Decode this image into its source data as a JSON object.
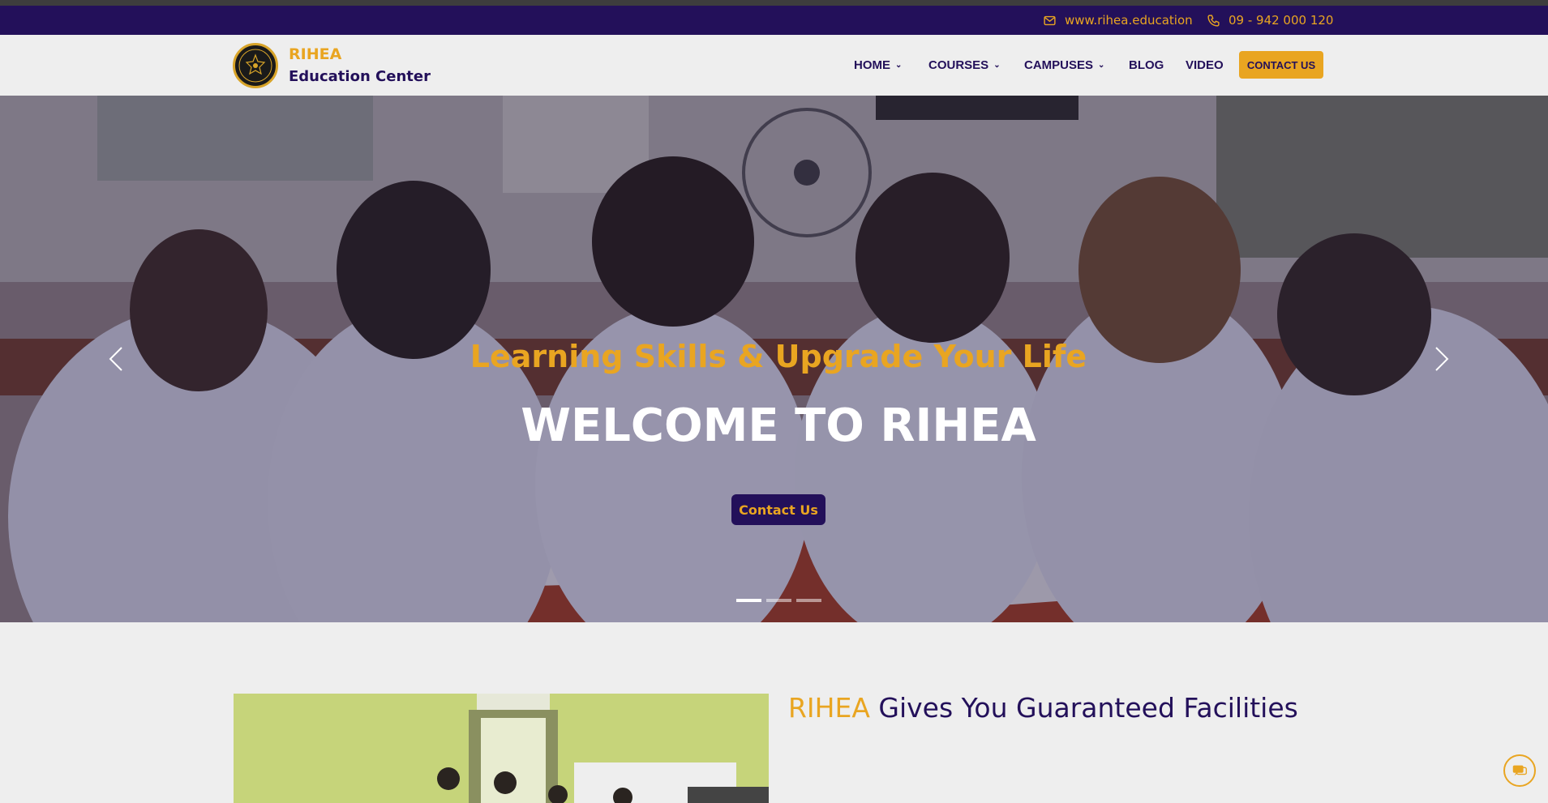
{
  "topbar": {
    "website": "www.rihea.education",
    "phone": "09 - 942 000 120"
  },
  "brand": {
    "name": "RIHEA",
    "subtitle": "Education Center"
  },
  "nav": {
    "items": [
      {
        "label": "HOME",
        "has_dropdown": true
      },
      {
        "label": "COURSES",
        "has_dropdown": true
      },
      {
        "label": "CAMPUSES",
        "has_dropdown": true
      },
      {
        "label": "BLOG",
        "has_dropdown": false
      },
      {
        "label": "VIDEO",
        "has_dropdown": false
      }
    ],
    "cta": "CONTACT US"
  },
  "hero": {
    "tagline": "Learning Skills & Upgrade Your Life",
    "title": "WELCOME TO RIHEA",
    "button": "Contact Us",
    "slide_count": 3,
    "active_slide": 1
  },
  "section": {
    "title_accent": "RIHEA",
    "title_rest": " Gives You Guaranteed Facilities"
  },
  "colors": {
    "brand_navy": "#23105a",
    "brand_gold": "#e9a521",
    "page_bg": "#eeeeee"
  },
  "icons": {
    "email": "envelope-icon",
    "phone": "phone-icon",
    "prev": "chevron-left-icon",
    "next": "chevron-right-icon",
    "chat": "chat-icon"
  }
}
